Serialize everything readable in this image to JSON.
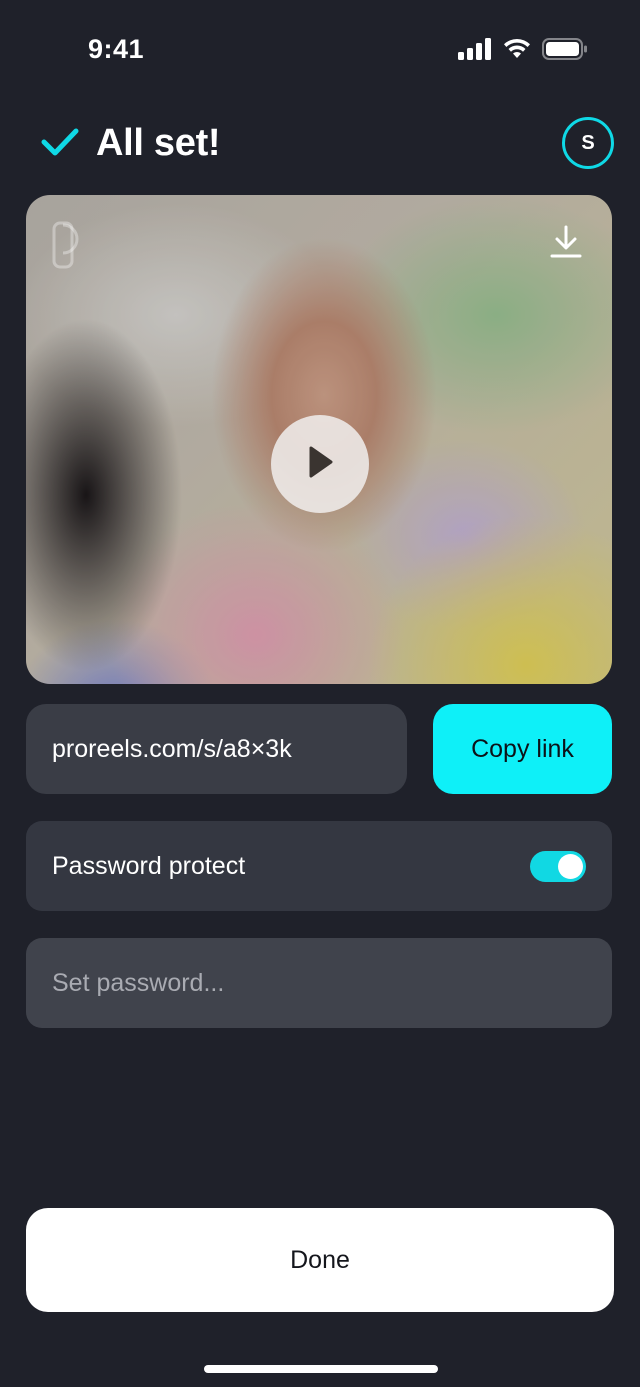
{
  "status_bar": {
    "time": "9:41",
    "icons": [
      "cellular-signal-icon",
      "wifi-icon",
      "battery-icon"
    ]
  },
  "header": {
    "title": "All set!",
    "icon": "checkmark-icon",
    "avatar_initial": "S"
  },
  "video": {
    "overlay_icons": [
      "brand-logo-icon",
      "download-icon",
      "play-icon"
    ]
  },
  "share": {
    "link": "proreels.com/s/a8×3k",
    "copy_label": "Copy link"
  },
  "password": {
    "label": "Password protect",
    "enabled": true,
    "placeholder": "Set password..."
  },
  "footer": {
    "done_label": "Done"
  },
  "colors": {
    "background": "#1f212a",
    "accent": "#0ef0f8",
    "field": "#3a3d46",
    "done_button": "#ffffff"
  }
}
